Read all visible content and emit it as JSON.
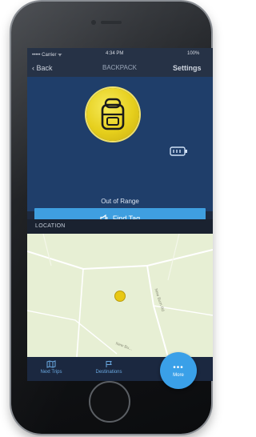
{
  "status_bar": {
    "carrier": "••••• Carrier ᯤ",
    "time": "4:34 PM",
    "battery": "100%"
  },
  "nav": {
    "back_label": "‹ Back",
    "title": "BACKPACK",
    "settings_label": "Settings"
  },
  "tag": {
    "status": "Out of Range",
    "icon": "backpack-icon",
    "find_button_label": "Find Tag"
  },
  "section": {
    "location_header": "LOCATION"
  },
  "map": {
    "road_label_1": "New Burn Rd",
    "road_label_2": "New Bu..."
  },
  "tabs": [
    {
      "label": "Next Trips",
      "icon": "map-icon"
    },
    {
      "label": "Destinations",
      "icon": "flag-icon"
    },
    {
      "label": "More",
      "icon": "ellipsis-icon"
    }
  ],
  "colors": {
    "accent": "#3f9fe0",
    "tag_yellow": "#e6cf1c",
    "hero_bg": "#1f3e6a"
  }
}
